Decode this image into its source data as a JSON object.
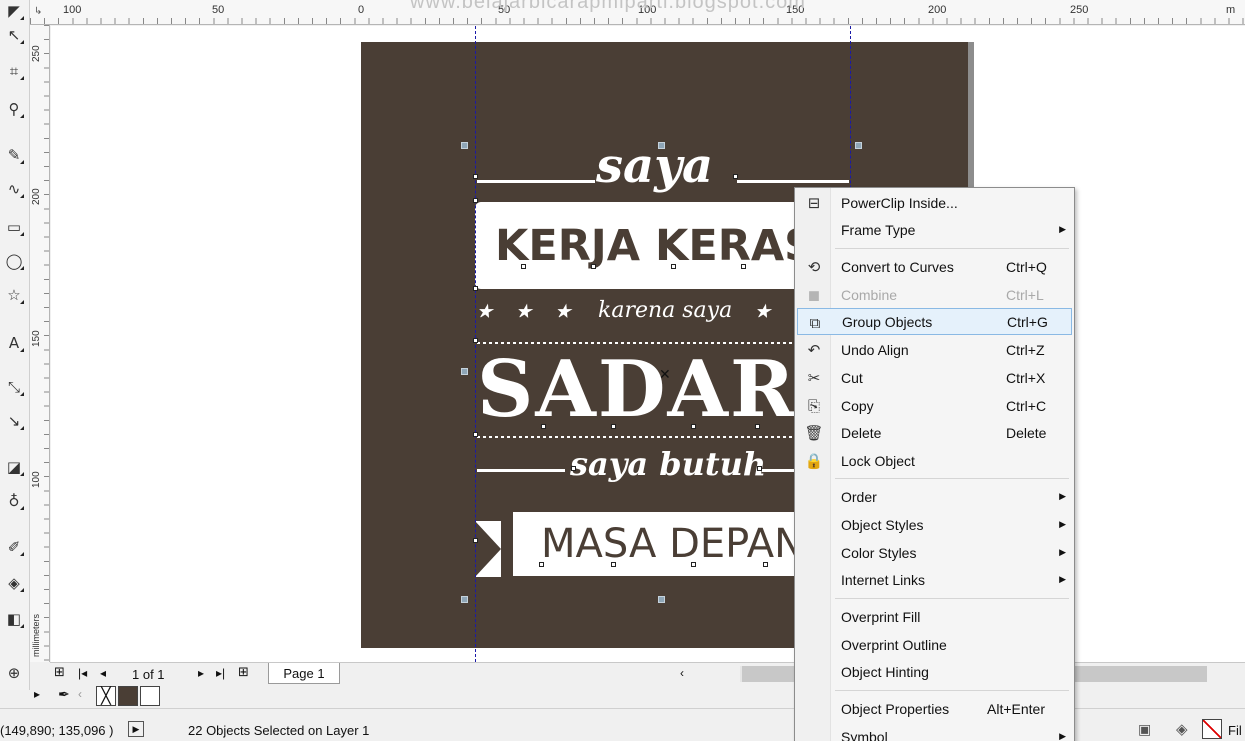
{
  "watermark": "www.belajarbicarapmiparti.blogspot.com",
  "ruler": {
    "h_numbers": [
      "100",
      "50",
      "0",
      "50",
      "100",
      "150",
      "200",
      "250"
    ],
    "v_numbers": [
      "250",
      "200",
      "150",
      "100"
    ],
    "unit_label": "millimeters",
    "corner_unit": "m"
  },
  "artwork": {
    "title_script": "saya",
    "line1": "KERJA KERAS",
    "mid_script": "karena saya",
    "line2": "SADAR",
    "bottom_script": "saya butuh",
    "line3": "MASA DEPAN",
    "colors": {
      "background": "#4a3e35",
      "ink": "#ffffff"
    }
  },
  "pagenav": {
    "page_count": "1 of 1",
    "page_tab": "Page 1"
  },
  "statusbar": {
    "coordinates": "(149,890; 135,096 )",
    "selection": "22 Objects Selected on Layer 1",
    "fill_label": "Fil"
  },
  "palette": {
    "swatches": [
      "#4a3e35",
      "#ffffff"
    ]
  },
  "context_menu": {
    "items": [
      {
        "icon": "powerclip-icon",
        "label": "PowerClip Inside...",
        "shortcut": "",
        "submenu": false
      },
      {
        "icon": "",
        "label": "Frame Type",
        "shortcut": "",
        "submenu": true
      },
      {
        "icon": "convert-curves-icon",
        "label": "Convert to Curves",
        "shortcut": "Ctrl+Q",
        "submenu": false
      },
      {
        "icon": "combine-icon",
        "label": "Combine",
        "shortcut": "Ctrl+L",
        "submenu": false,
        "disabled": true
      },
      {
        "icon": "group-icon",
        "label": "Group Objects",
        "shortcut": "Ctrl+G",
        "submenu": false,
        "highlighted": true
      },
      {
        "icon": "undo-icon",
        "label": "Undo Align",
        "shortcut": "Ctrl+Z",
        "submenu": false
      },
      {
        "icon": "scissors-icon",
        "label": "Cut",
        "shortcut": "Ctrl+X",
        "submenu": false
      },
      {
        "icon": "copy-icon",
        "label": "Copy",
        "shortcut": "Ctrl+C",
        "submenu": false
      },
      {
        "icon": "trash-icon",
        "label": "Delete",
        "shortcut": "Delete",
        "submenu": false
      },
      {
        "icon": "lock-icon",
        "label": "Lock Object",
        "shortcut": "",
        "submenu": false
      },
      {
        "icon": "",
        "label": "Order",
        "shortcut": "",
        "submenu": true
      },
      {
        "icon": "",
        "label": "Object Styles",
        "shortcut": "",
        "submenu": true
      },
      {
        "icon": "",
        "label": "Color Styles",
        "shortcut": "",
        "submenu": true
      },
      {
        "icon": "",
        "label": "Internet Links",
        "shortcut": "",
        "submenu": true
      },
      {
        "icon": "",
        "label": "Overprint Fill",
        "shortcut": "",
        "submenu": false
      },
      {
        "icon": "",
        "label": "Overprint Outline",
        "shortcut": "",
        "submenu": false
      },
      {
        "icon": "",
        "label": "Object Hinting",
        "shortcut": "",
        "submenu": false
      },
      {
        "icon": "",
        "label": "Object Properties",
        "shortcut": "Alt+Enter",
        "submenu": false
      },
      {
        "icon": "",
        "label": "Symbol",
        "shortcut": "",
        "submenu": true
      }
    ]
  }
}
